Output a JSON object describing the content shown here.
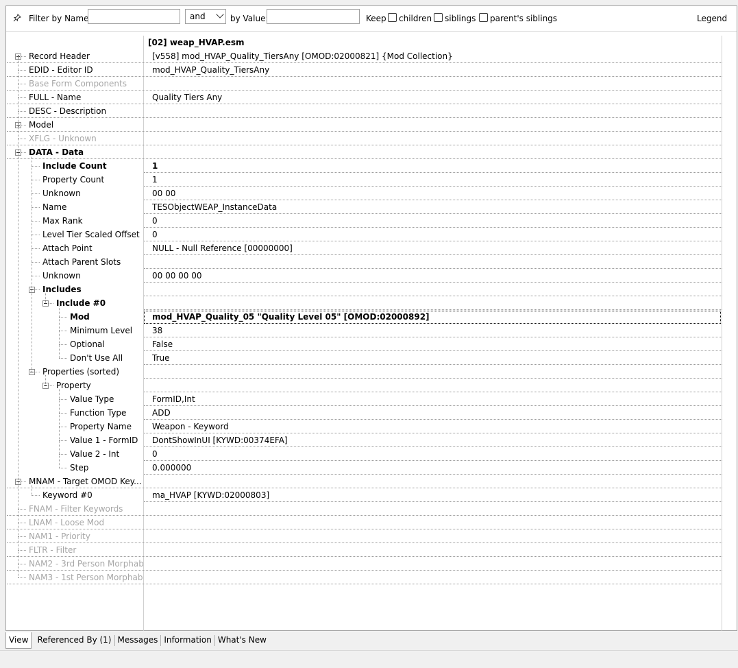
{
  "filter": {
    "filter_by_name_label": "Filter by Name:",
    "name_value": "",
    "operator": "and",
    "by_value_label": "by Value:",
    "value_value": "",
    "keep_label": "Keep",
    "children_label": "children",
    "siblings_label": "siblings",
    "parents_siblings_label": "parent's siblings",
    "legend_label": "Legend"
  },
  "grid": {
    "column_header": "[02] weap_HVAP.esm",
    "rows": [
      {
        "name": "Record Header",
        "value": "[v558] mod_HVAP_Quality_TiersAny [OMOD:02000821] {Mod Collection}"
      },
      {
        "name": "EDID - Editor ID",
        "value": "mod_HVAP_Quality_TiersAny"
      },
      {
        "name": "Base Form Components",
        "value": ""
      },
      {
        "name": "FULL - Name",
        "value": "Quality Tiers Any"
      },
      {
        "name": "DESC - Description",
        "value": ""
      },
      {
        "name": "Model",
        "value": ""
      },
      {
        "name": "XFLG - Unknown",
        "value": ""
      },
      {
        "name": "DATA - Data",
        "value": ""
      },
      {
        "name": "Include Count",
        "value": "1"
      },
      {
        "name": "Property Count",
        "value": "1"
      },
      {
        "name": "Unknown",
        "value": "00 00"
      },
      {
        "name": "Name",
        "value": "TESObjectWEAP_InstanceData"
      },
      {
        "name": "Max Rank",
        "value": "0"
      },
      {
        "name": "Level Tier Scaled Offset",
        "value": "0"
      },
      {
        "name": "Attach Point",
        "value": "NULL - Null Reference [00000000]"
      },
      {
        "name": "Attach Parent Slots",
        "value": ""
      },
      {
        "name": "Unknown",
        "value": "00 00 00 00"
      },
      {
        "name": "Includes",
        "value": ""
      },
      {
        "name": "Include #0",
        "value": ""
      },
      {
        "name": "Mod",
        "value": "mod_HVAP_Quality_05 \"Quality Level 05\" [OMOD:02000892]"
      },
      {
        "name": "Minimum Level",
        "value": "38"
      },
      {
        "name": "Optional",
        "value": "False"
      },
      {
        "name": "Don't Use All",
        "value": "True"
      },
      {
        "name": "Properties (sorted)",
        "value": ""
      },
      {
        "name": "Property",
        "value": ""
      },
      {
        "name": "Value Type",
        "value": "FormID,Int"
      },
      {
        "name": "Function Type",
        "value": "ADD"
      },
      {
        "name": "Property Name",
        "value": "Weapon - Keyword"
      },
      {
        "name": "Value 1 - FormID",
        "value": "DontShowInUI [KYWD:00374EFA]"
      },
      {
        "name": "Value 2 - Int",
        "value": "0"
      },
      {
        "name": "Step",
        "value": "0.000000"
      },
      {
        "name": "MNAM - Target OMOD Key...",
        "value": ""
      },
      {
        "name": "Keyword #0",
        "value": "ma_HVAP [KYWD:02000803]"
      },
      {
        "name": "FNAM - Filter Keywords",
        "value": ""
      },
      {
        "name": "LNAM - Loose Mod",
        "value": ""
      },
      {
        "name": "NAM1 - Priority",
        "value": ""
      },
      {
        "name": "FLTR - Filter",
        "value": ""
      },
      {
        "name": "NAM2 - 3rd Person Morphab...",
        "value": ""
      },
      {
        "name": "NAM3 - 1st Person Morphab...",
        "value": ""
      }
    ]
  },
  "tabs": [
    "View",
    "Referenced By (1)",
    "Messages",
    "Information",
    "What's New"
  ]
}
